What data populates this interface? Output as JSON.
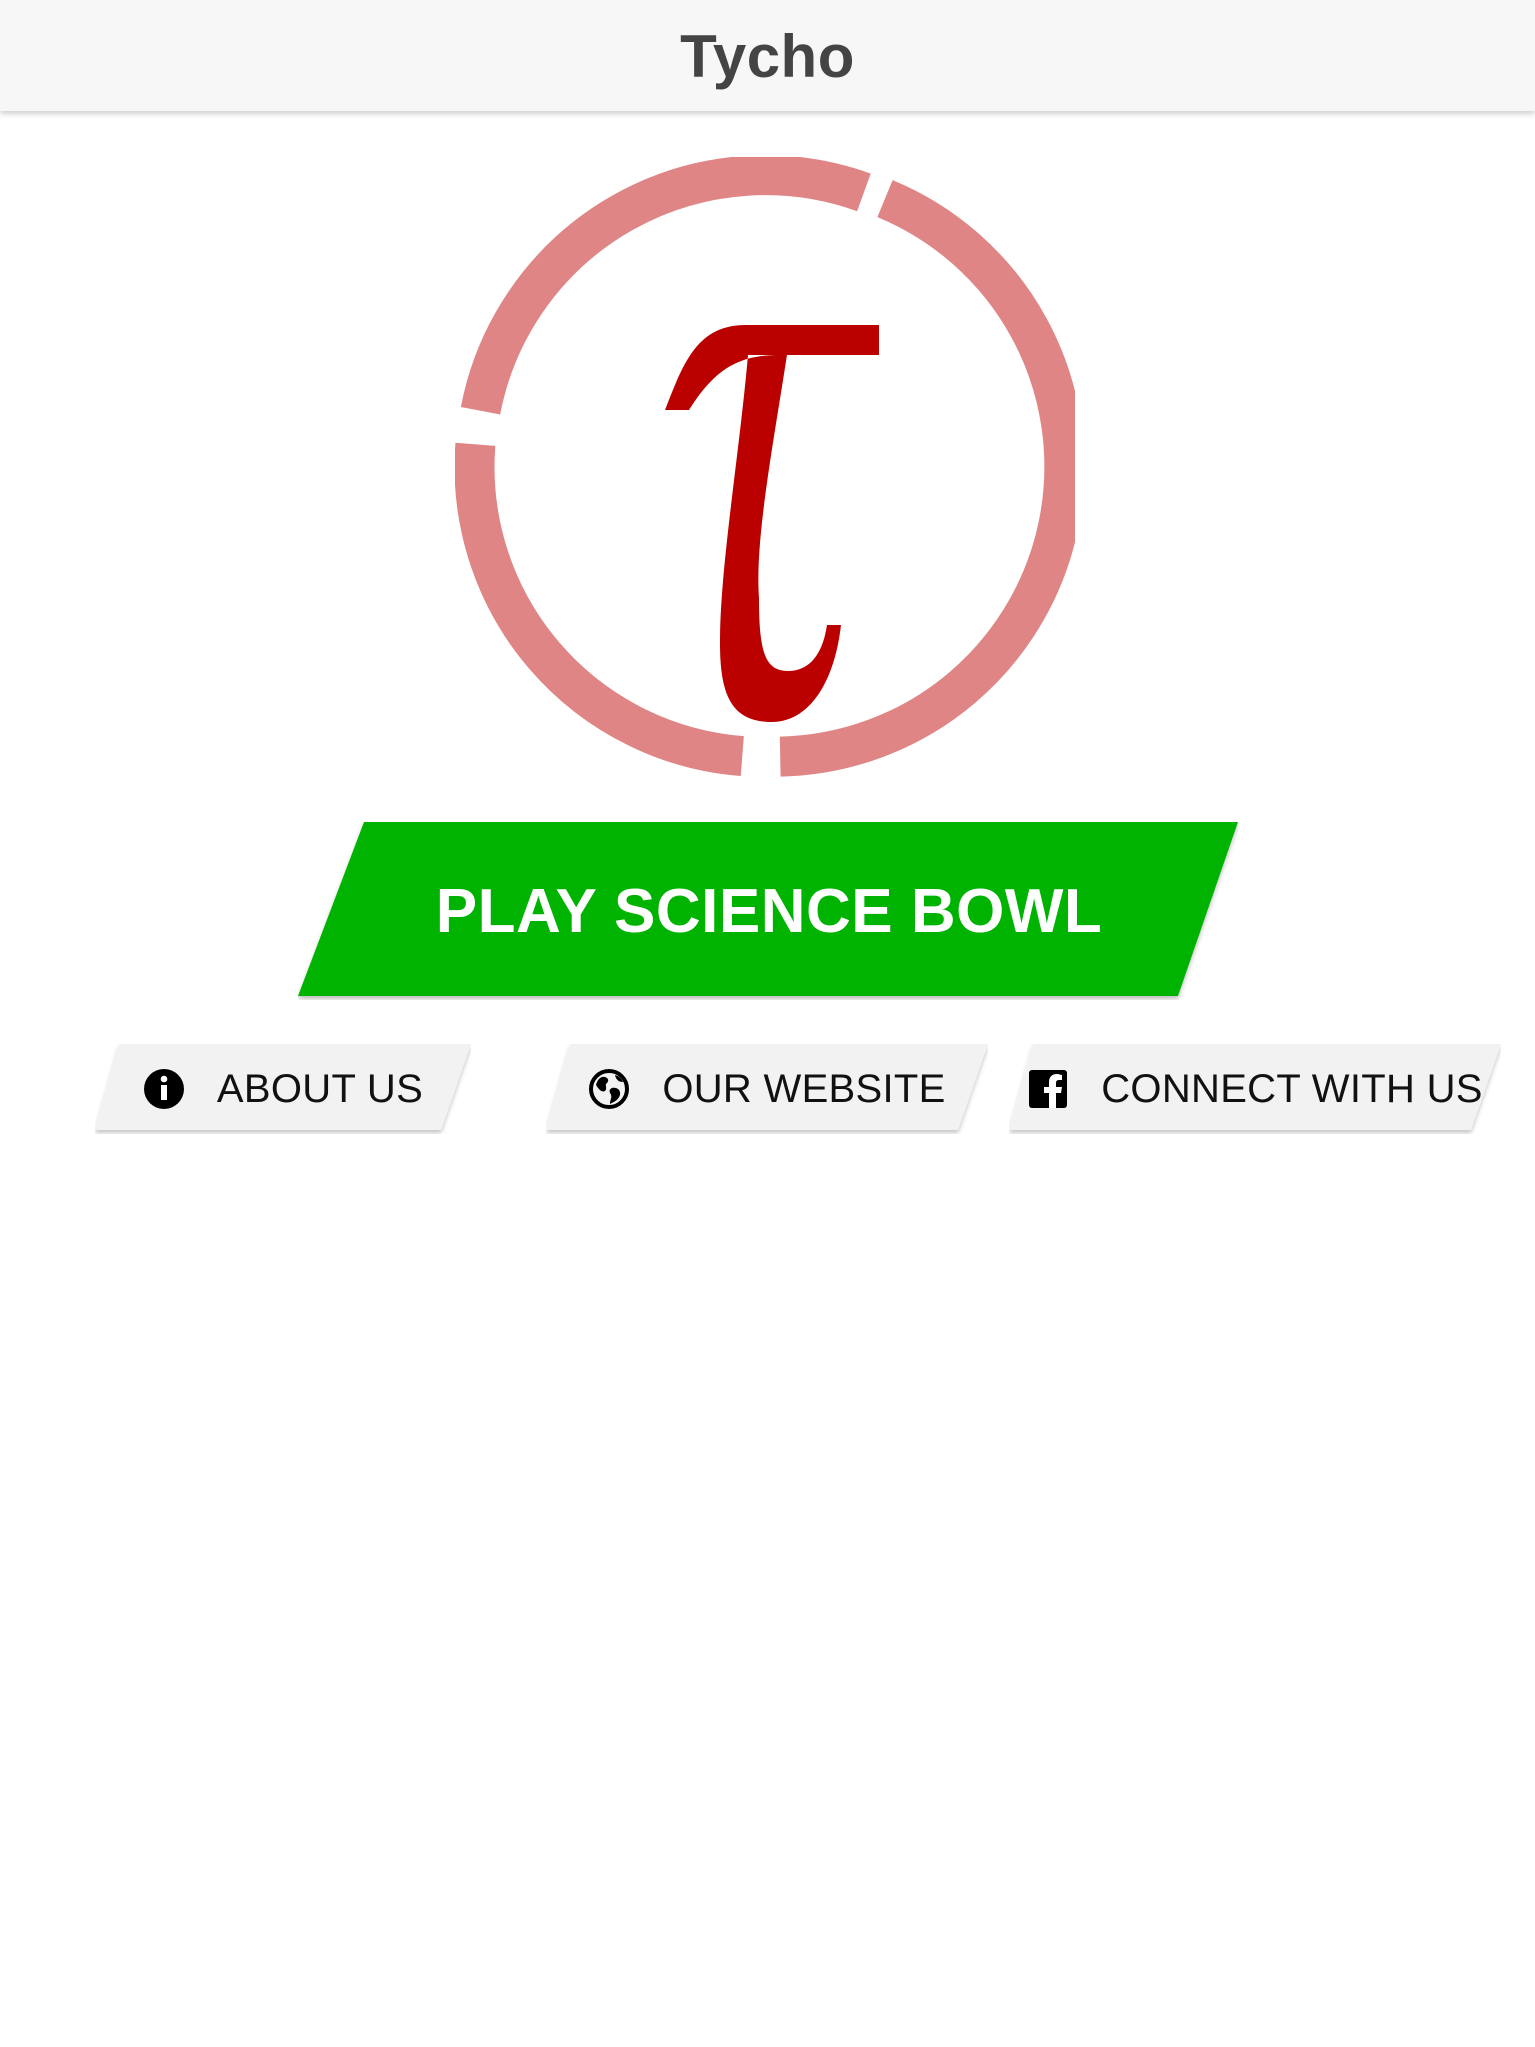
{
  "app": {
    "title": "Tycho"
  },
  "logo": {
    "glyph": "τ",
    "glyph_color": "#bb0000",
    "ring_color": "#e08585"
  },
  "play_button": {
    "label": "PLAY SCIENCE BOWL",
    "color": "#00b300"
  },
  "nav_buttons": [
    {
      "label": "ABOUT US",
      "icon": "info-icon"
    },
    {
      "label": "OUR WEBSITE",
      "icon": "globe-icon"
    },
    {
      "label": "CONNECT WITH US",
      "icon": "facebook-icon"
    }
  ],
  "colors": {
    "topbar_bg": "#f7f7f7",
    "nav_button_bg": "#f2f2f2"
  }
}
